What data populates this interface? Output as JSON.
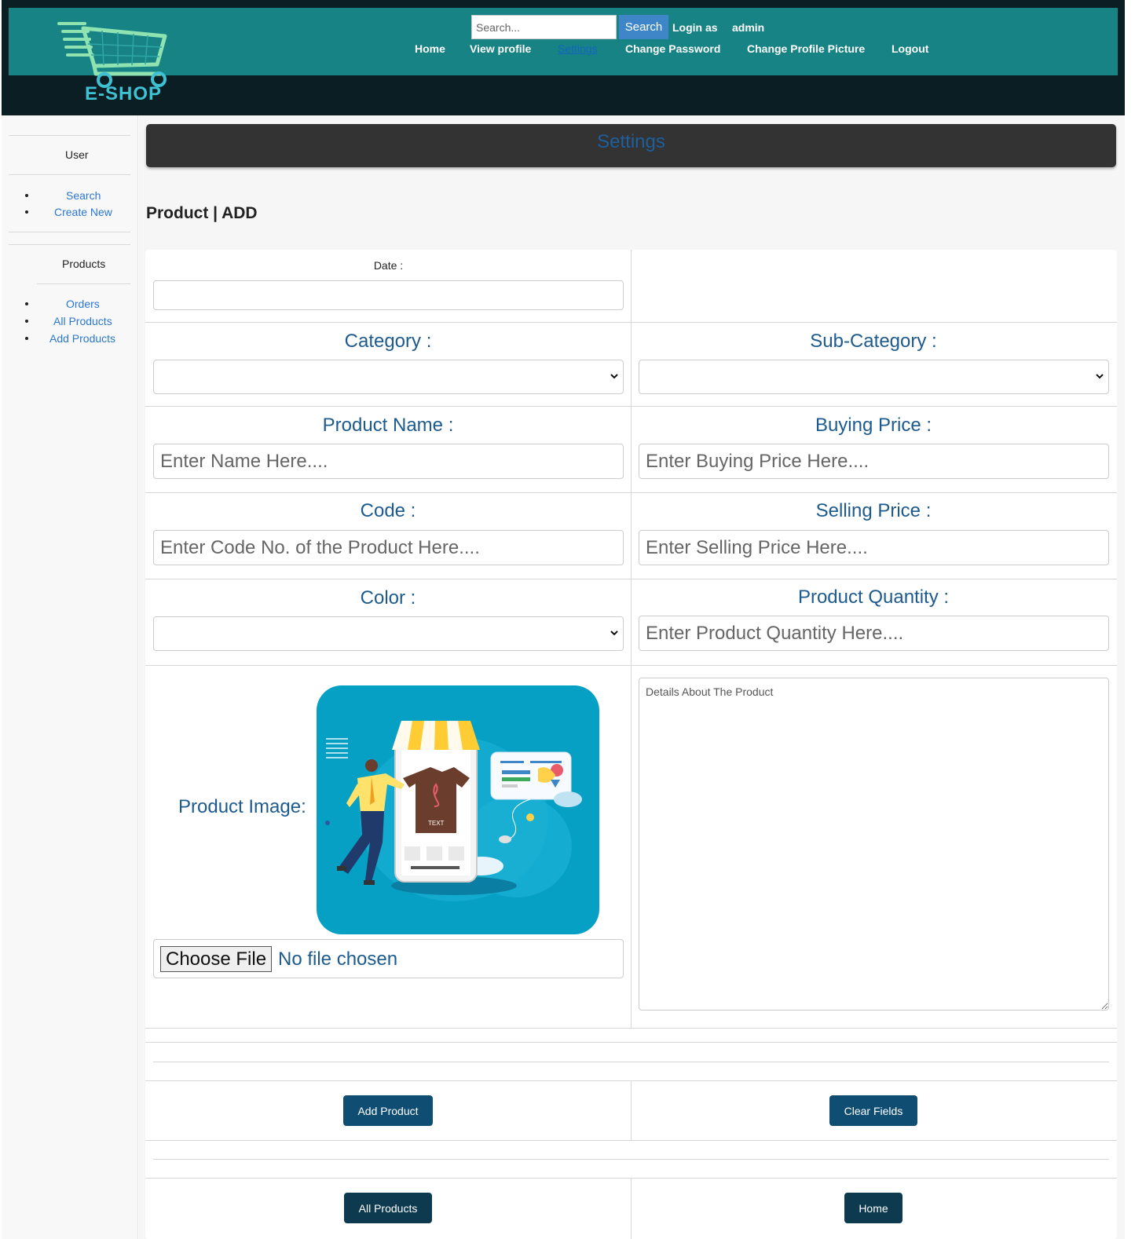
{
  "header": {
    "logo_text": "E-SHOP",
    "search_placeholder": "Search...",
    "search_button": "Search",
    "login_as_label": "Login as",
    "username": "admin",
    "nav": [
      "Home",
      "View profile",
      "Settings",
      "Change Password",
      "Change Profile Picture",
      "Logout"
    ],
    "active_nav": "Settings"
  },
  "sidebar": {
    "user_heading": "User",
    "user_links": [
      "Search",
      "Create New"
    ],
    "products_heading": "Products",
    "products_links": [
      "Orders",
      "All Products",
      "Add Products"
    ]
  },
  "main": {
    "banner_title": "Settings",
    "page_heading": "Product | ADD",
    "form": {
      "date_label": "Date :",
      "category_label": "Category :",
      "subcategory_label": "Sub-Category :",
      "product_name_label": "Product Name :",
      "product_name_placeholder": "Enter Name Here....",
      "buying_price_label": "Buying Price :",
      "buying_price_placeholder": "Enter Buying Price Here....",
      "code_label": "Code :",
      "code_placeholder": "Enter Code No. of the Product Here....",
      "selling_price_label": "Selling Price :",
      "selling_price_placeholder": "Enter Selling Price Here....",
      "color_label": "Color :",
      "quantity_label": "Product Quantity :",
      "quantity_placeholder": "Enter Product Quantity Here....",
      "image_label": "Product Image:",
      "illustration_text": "TEXT",
      "choose_file_button": "Choose File",
      "no_file_text": "No file chosen",
      "details_placeholder": "Details About The Product"
    },
    "buttons": {
      "add_product": "Add Product",
      "clear_fields": "Clear Fields",
      "all_products": "All Products",
      "home": "Home"
    }
  },
  "colors": {
    "header_teal": "#178384",
    "header_dark": "#0b1e24",
    "label_blue": "#1d5b8f",
    "button_dark": "#0f4d73",
    "link_blue": "#2b78d0"
  }
}
